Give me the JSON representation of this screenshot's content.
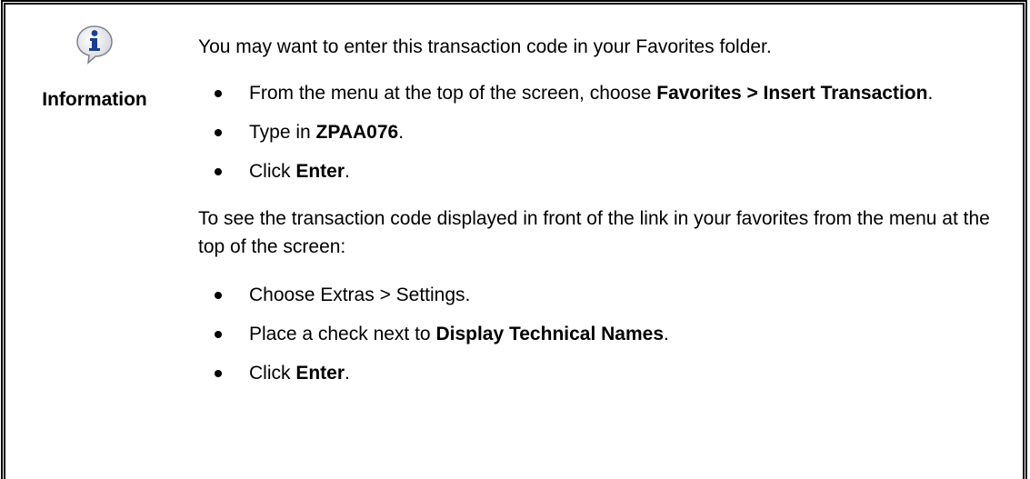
{
  "sidebar": {
    "icon": "information-icon",
    "label": "Information"
  },
  "intro": "You may want to enter this transaction code in your Favorites folder.",
  "steps_1": [
    {
      "pre": "From the menu at the top of the screen, choose ",
      "bold": "Favorites > Insert Transaction",
      "post": "."
    },
    {
      "pre": "Type in ",
      "bold": "ZPAA076",
      "post": "."
    },
    {
      "pre": "Click ",
      "bold": "Enter",
      "post": "."
    }
  ],
  "second": "To see the transaction code displayed in front of the link in your favorites from the menu at the top of the screen:",
  "steps_2": [
    {
      "pre": "Choose Extras > Settings.",
      "bold": "",
      "post": ""
    },
    {
      "pre": "Place a check next to ",
      "bold": "Display Technical Names",
      "post": "."
    },
    {
      "pre": "Click ",
      "bold": "Enter",
      "post": "."
    }
  ],
  "colors": {
    "icon_fill": "#1a3f8f",
    "icon_bubble": "#e8eaee",
    "border": "#000000"
  }
}
